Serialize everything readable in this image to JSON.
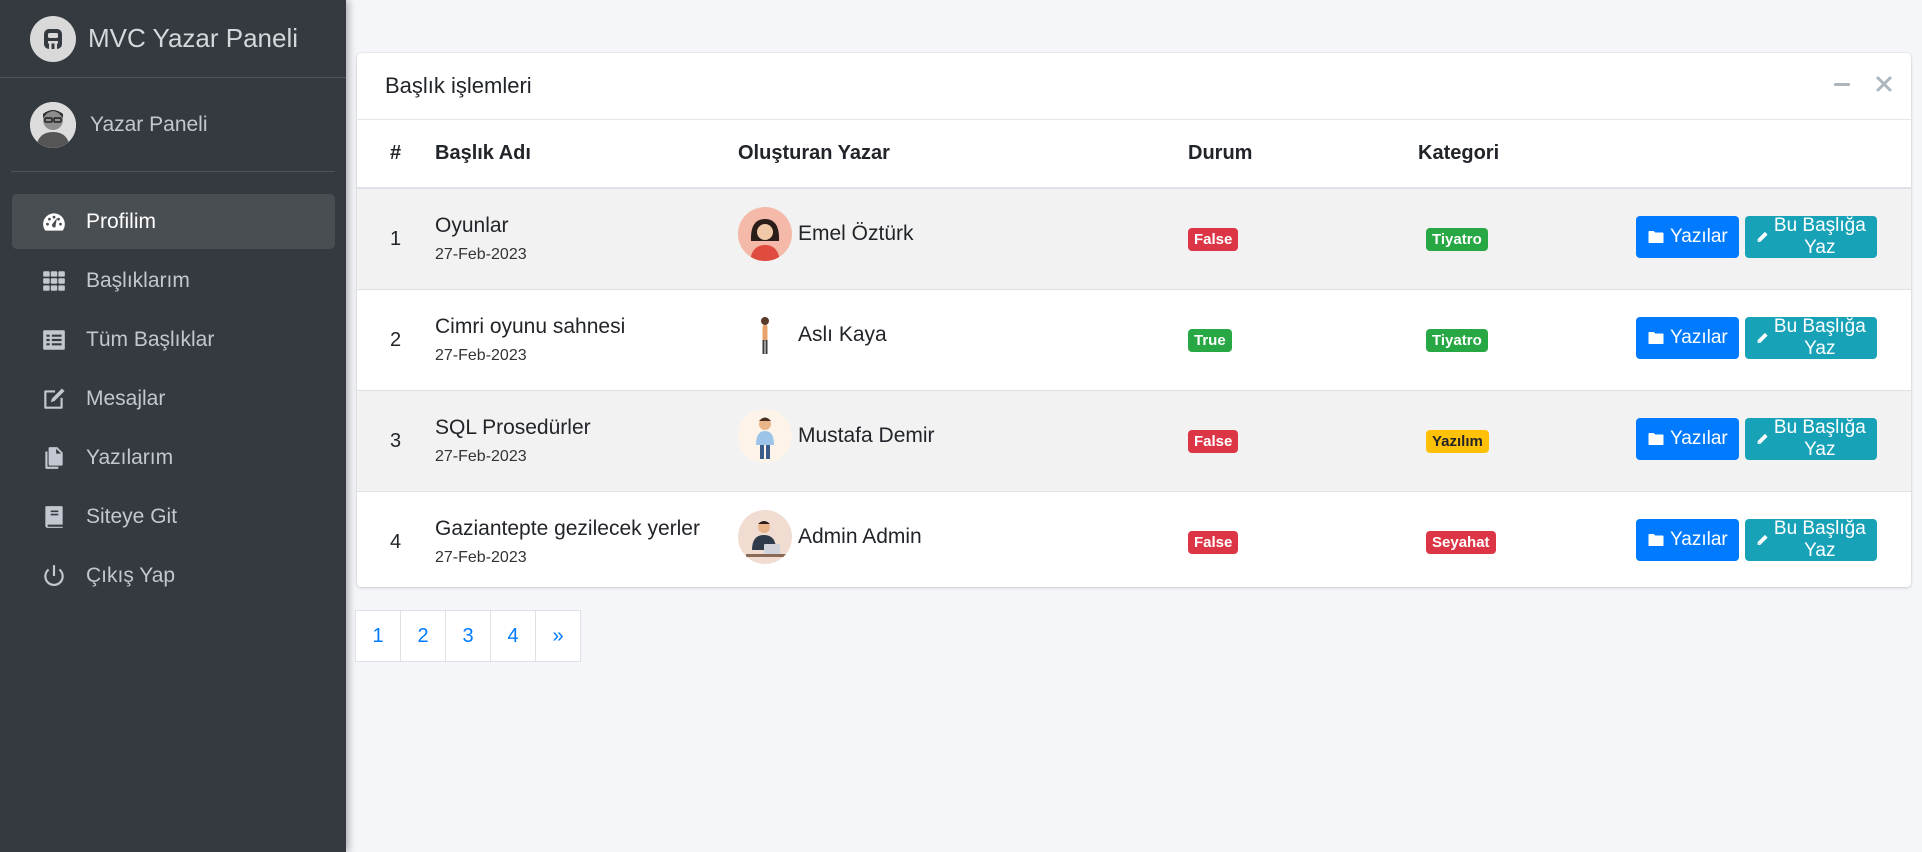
{
  "sidebar": {
    "brand": "MVC Yazar Paneli",
    "user_name": "Yazar Paneli",
    "items": [
      {
        "label": "Profilim",
        "icon": "dashboard-icon",
        "active": true
      },
      {
        "label": "Başlıklarım",
        "icon": "grid-icon"
      },
      {
        "label": "Tüm Başlıklar",
        "icon": "list-icon"
      },
      {
        "label": "Mesajlar",
        "icon": "edit-icon"
      },
      {
        "label": "Yazılarım",
        "icon": "copy-icon"
      },
      {
        "label": "Siteye Git",
        "icon": "book-icon"
      },
      {
        "label": "Çıkış Yap",
        "icon": "power-icon"
      }
    ]
  },
  "card": {
    "title": "Başlık işlemleri",
    "headers": {
      "num": "#",
      "title": "Başlık Adı",
      "author": "Oluşturan Yazar",
      "status": "Durum",
      "category": "Kategori"
    },
    "rows": [
      {
        "num": "1",
        "title": "Oyunlar",
        "date": "27-Feb-2023",
        "author": "Emel Öztürk",
        "status": "False",
        "category": "Tiyatro",
        "category_color": "#28a745",
        "status_color": "#dc3545"
      },
      {
        "num": "2",
        "title": "Cimri oyunu sahnesi",
        "date": "27-Feb-2023",
        "author": "Aslı Kaya",
        "status": "True",
        "category": "Tiyatro",
        "category_color": "#28a745",
        "status_color": "#28a745"
      },
      {
        "num": "3",
        "title": "SQL Prosedürler",
        "date": "27-Feb-2023",
        "author": "Mustafa Demir",
        "status": "False",
        "category": "Yazılım",
        "category_color": "#ffc107",
        "status_color": "#dc3545"
      },
      {
        "num": "4",
        "title": "Gaziantepte gezilecek yerler",
        "date": "27-Feb-2023",
        "author": "Admin Admin",
        "status": "False",
        "category": "Seyahat",
        "category_color": "#dc3545",
        "status_color": "#dc3545"
      }
    ],
    "btn_posts": "Yazılar",
    "btn_write": "Bu Başlığa Yaz"
  },
  "pagination": [
    "1",
    "2",
    "3",
    "4",
    "»"
  ]
}
